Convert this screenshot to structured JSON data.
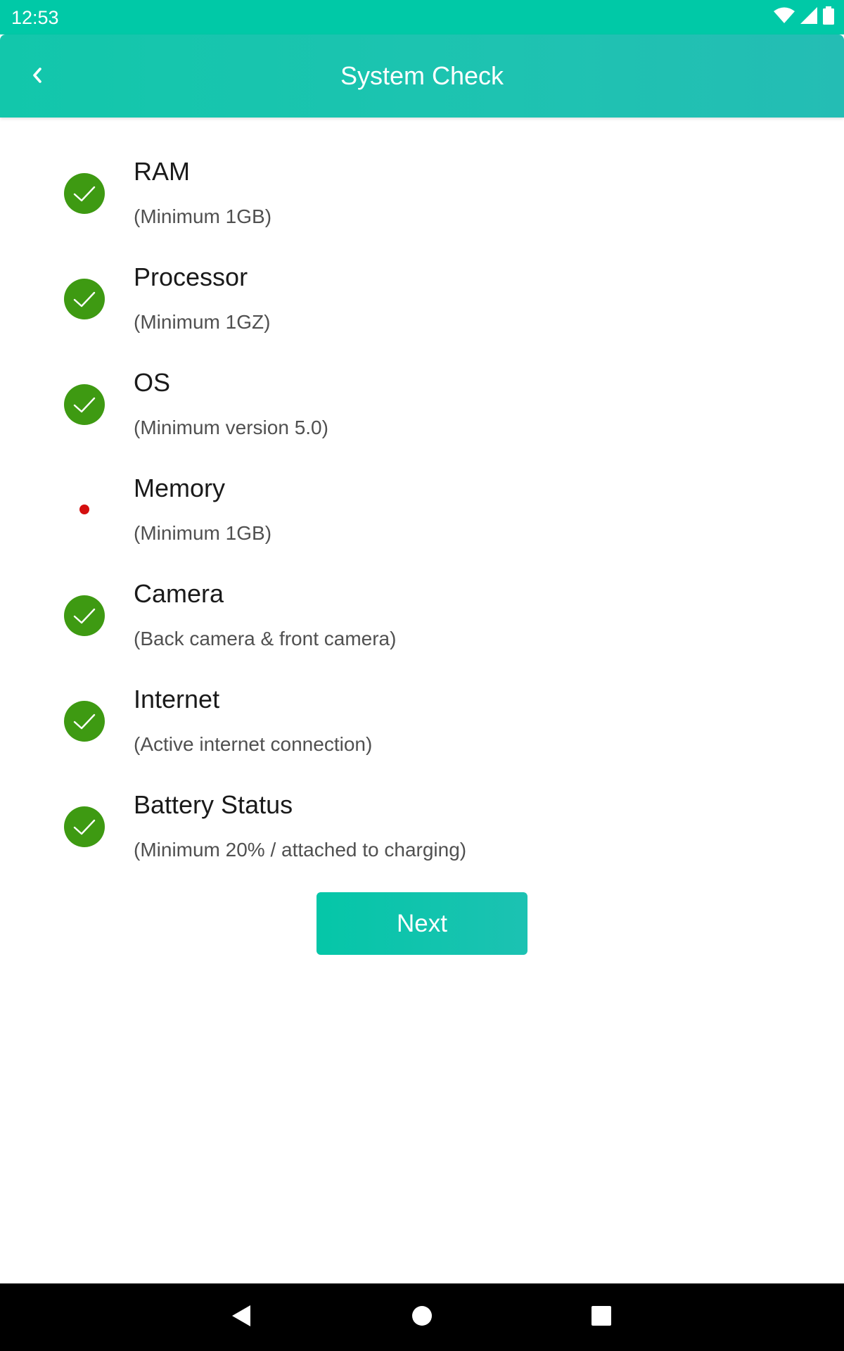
{
  "status_bar": {
    "time": "12:53",
    "icons": [
      "wifi-icon",
      "signal-icon",
      "battery-icon"
    ]
  },
  "app_bar": {
    "title": "System Check",
    "back_icon": "chevron-left-icon"
  },
  "checks": [
    {
      "title": "RAM",
      "subtitle": "(Minimum 1GB)",
      "status": "pass"
    },
    {
      "title": "Processor",
      "subtitle": "(Minimum 1GZ)",
      "status": "pass"
    },
    {
      "title": "OS",
      "subtitle": "(Minimum version 5.0)",
      "status": "pass"
    },
    {
      "title": "Memory",
      "subtitle": "(Minimum 1GB)",
      "status": "fail"
    },
    {
      "title": "Camera",
      "subtitle": "(Back camera & front camera)",
      "status": "pass"
    },
    {
      "title": "Internet",
      "subtitle": "(Active internet connection)",
      "status": "pass"
    },
    {
      "title": "Battery Status",
      "subtitle": "(Minimum 20% / attached to charging)",
      "status": "pass"
    }
  ],
  "next_button": {
    "label": "Next"
  },
  "colors": {
    "accent": "#00c9a7",
    "pass": "#3e9a12",
    "fail": "#d40f0f"
  },
  "nav_bar": {
    "buttons": [
      "back-triangle-icon",
      "home-circle-icon",
      "recents-square-icon"
    ]
  }
}
